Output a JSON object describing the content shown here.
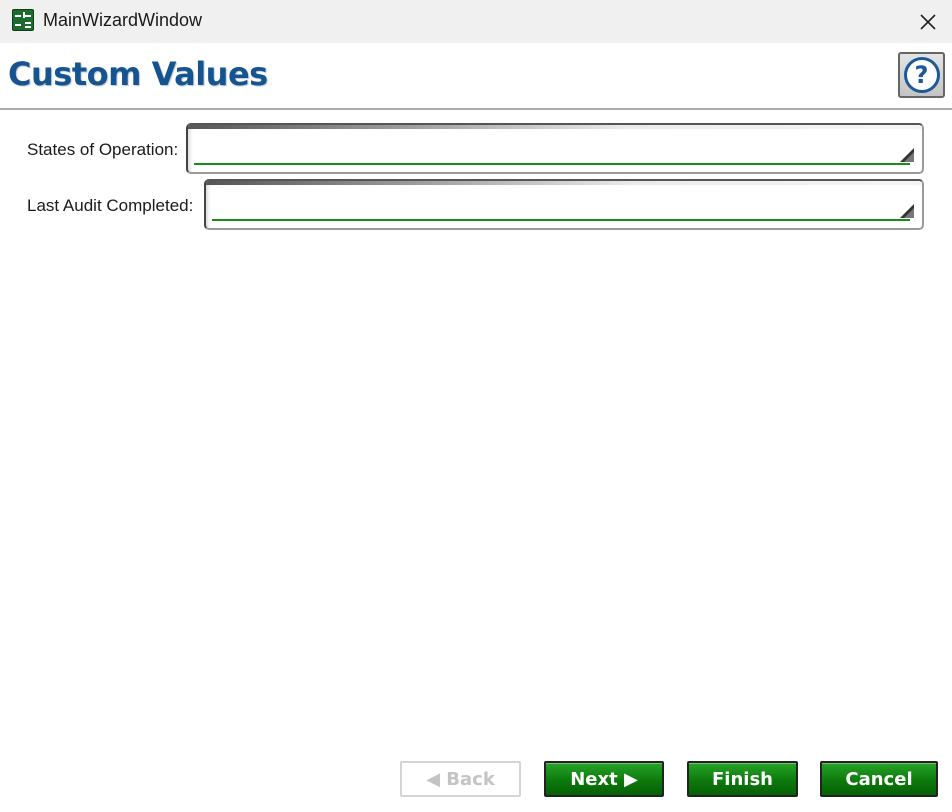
{
  "window": {
    "title": "MainWizardWindow",
    "app_icon": "spreadsheet-icon",
    "close_icon": "close-icon"
  },
  "header": {
    "title": "Custom Values",
    "help_label": "?",
    "title_color": "#15548e"
  },
  "fields": [
    {
      "label": "States of Operation:",
      "value": ""
    },
    {
      "label": "Last Audit Completed:",
      "value": ""
    }
  ],
  "footer": {
    "back_label": "◀ Back",
    "next_label": "Next ▶",
    "finish_label": "Finish",
    "cancel_label": "Cancel",
    "back_enabled": false,
    "button_color": "#0c7a0c"
  }
}
